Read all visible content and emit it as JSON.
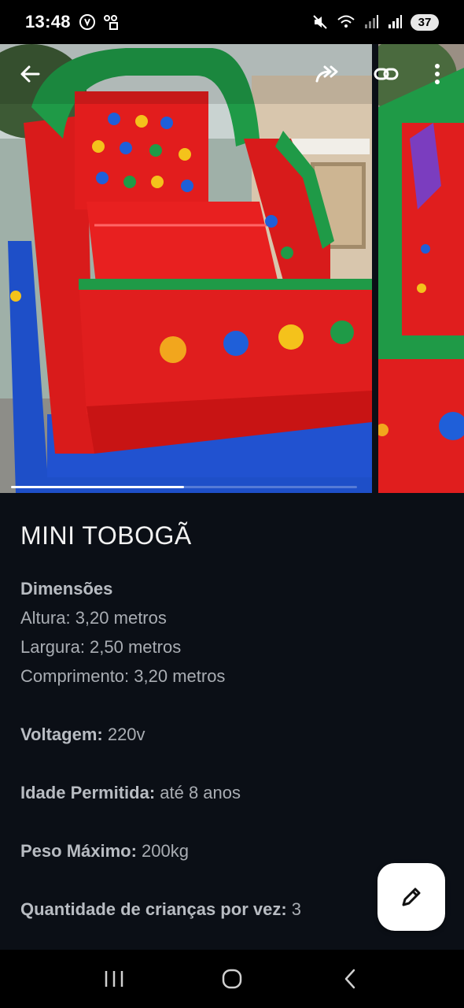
{
  "status_bar": {
    "time": "13:48",
    "battery_level": "37",
    "icons": [
      "whatsapp-icon",
      "notification-icon",
      "mute-icon",
      "wifi-icon",
      "signal-icon",
      "signal-icon"
    ]
  },
  "top_bar": {
    "back_icon": "back-arrow-icon",
    "share_icon": "share-forward-icon",
    "link_icon": "link-icon",
    "menu_icon": "more-vertical-icon"
  },
  "carousel": {
    "images": [
      "inflatable-slide-photo-1",
      "inflatable-slide-photo-2"
    ],
    "progress": 0.5
  },
  "product": {
    "title": "MINI TOBOGÃ",
    "dimensions_label": "Dimensões",
    "height_line": "Altura: 3,20 metros",
    "width_line": "Largura: 2,50 metros",
    "length_line": "Comprimento: 3,20 metros",
    "voltage_label": "Voltagem:",
    "voltage_value": " 220v",
    "age_label": "Idade Permitida:",
    "age_value": " até 8 anos",
    "weight_label": "Peso Máximo:",
    "weight_value": " 200kg",
    "kids_label": "Quantidade de crianças por vez:",
    "kids_value": " 3"
  },
  "fab": {
    "icon": "edit-pencil-icon"
  },
  "nav_bar": {
    "recents_icon": "recents-icon",
    "home_icon": "home-icon",
    "back_icon": "nav-back-icon"
  },
  "colors": {
    "background": "#0b0f16",
    "text_primary": "#f2f2f2",
    "text_secondary": "#a9adb3",
    "fab_bg": "#ffffff"
  }
}
